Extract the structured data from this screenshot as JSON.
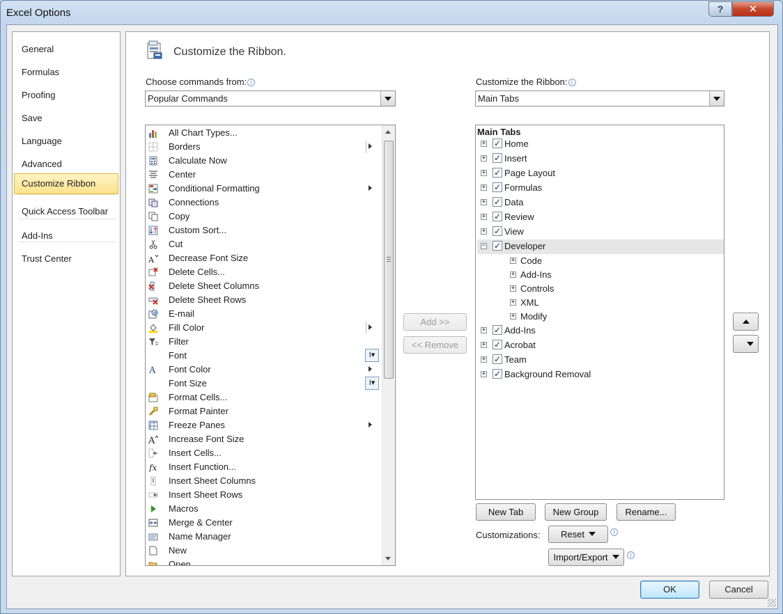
{
  "window": {
    "title": "Excel Options",
    "help_label": "?",
    "close_label": "✕"
  },
  "nav": {
    "items": [
      {
        "label": "General"
      },
      {
        "label": "Formulas"
      },
      {
        "label": "Proofing"
      },
      {
        "label": "Save"
      },
      {
        "label": "Language"
      },
      {
        "label": "Advanced"
      },
      {
        "label": "Customize Ribbon",
        "selected": true
      },
      {
        "label": "Quick Access Toolbar"
      },
      {
        "label": "Add-Ins"
      },
      {
        "label": "Trust Center"
      }
    ]
  },
  "header": {
    "title": "Customize the Ribbon.",
    "icon": "customize-ribbon-icon"
  },
  "left": {
    "label": "Choose commands from:",
    "dropdown_value": "Popular Commands",
    "commands": [
      {
        "label": "All Chart Types...",
        "icon": "chart-icon"
      },
      {
        "label": "Borders",
        "icon": "borders-icon",
        "submenu": true,
        "divider": true
      },
      {
        "label": "Calculate Now",
        "icon": "calculator-icon"
      },
      {
        "label": "Center",
        "icon": "align-center-icon"
      },
      {
        "label": "Conditional Formatting",
        "icon": "conditional-formatting-icon",
        "submenu": true
      },
      {
        "label": "Connections",
        "icon": "connections-icon"
      },
      {
        "label": "Copy",
        "icon": "copy-icon"
      },
      {
        "label": "Custom Sort...",
        "icon": "sort-icon"
      },
      {
        "label": "Cut",
        "icon": "scissors-icon"
      },
      {
        "label": "Decrease Font Size",
        "icon": "decrease-font-icon"
      },
      {
        "label": "Delete Cells...",
        "icon": "delete-cells-icon"
      },
      {
        "label": "Delete Sheet Columns",
        "icon": "delete-columns-icon"
      },
      {
        "label": "Delete Sheet Rows",
        "icon": "delete-rows-icon"
      },
      {
        "label": "E-mail",
        "icon": "email-icon"
      },
      {
        "label": "Fill Color",
        "icon": "fill-color-icon",
        "submenu": true,
        "divider": true
      },
      {
        "label": "Filter",
        "icon": "filter-icon"
      },
      {
        "label": "Font",
        "icon": "",
        "fontctl": true
      },
      {
        "label": "Font Color",
        "icon": "font-color-icon",
        "submenu": true
      },
      {
        "label": "Font Size",
        "icon": "",
        "fontctl": true
      },
      {
        "label": "Format Cells...",
        "icon": "format-cells-icon"
      },
      {
        "label": "Format Painter",
        "icon": "format-painter-icon"
      },
      {
        "label": "Freeze Panes",
        "icon": "freeze-panes-icon",
        "submenu": true
      },
      {
        "label": "Increase Font Size",
        "icon": "increase-font-icon"
      },
      {
        "label": "Insert Cells...",
        "icon": "insert-cells-icon"
      },
      {
        "label": "Insert Function...",
        "icon": "function-icon"
      },
      {
        "label": "Insert Sheet Columns",
        "icon": "insert-columns-icon"
      },
      {
        "label": "Insert Sheet Rows",
        "icon": "insert-rows-icon"
      },
      {
        "label": "Macros",
        "icon": "macro-play-icon"
      },
      {
        "label": "Merge & Center",
        "icon": "merge-center-icon"
      },
      {
        "label": "Name Manager",
        "icon": "name-manager-icon"
      },
      {
        "label": "New",
        "icon": "new-document-icon"
      },
      {
        "label": "Open",
        "icon": "open-folder-icon"
      }
    ]
  },
  "middle": {
    "add_label": "Add >>",
    "remove_label": "<< Remove"
  },
  "right": {
    "label": "Customize the Ribbon:",
    "dropdown_value": "Main Tabs",
    "tree_header": "Main Tabs",
    "nodes": [
      {
        "label": "Home",
        "level": 0,
        "expand": "+",
        "checked": true
      },
      {
        "label": "Insert",
        "level": 0,
        "expand": "+",
        "checked": true
      },
      {
        "label": "Page Layout",
        "level": 0,
        "expand": "+",
        "checked": true
      },
      {
        "label": "Formulas",
        "level": 0,
        "expand": "+",
        "checked": true
      },
      {
        "label": "Data",
        "level": 0,
        "expand": "+",
        "checked": true
      },
      {
        "label": "Review",
        "level": 0,
        "expand": "+",
        "checked": true
      },
      {
        "label": "View",
        "level": 0,
        "expand": "+",
        "checked": true
      },
      {
        "label": "Developer",
        "level": 0,
        "expand": "−",
        "checked": true,
        "selected": true
      },
      {
        "label": "Code",
        "level": 1,
        "expand": "+"
      },
      {
        "label": "Add-Ins",
        "level": 1,
        "expand": "+"
      },
      {
        "label": "Controls",
        "level": 1,
        "expand": "+"
      },
      {
        "label": "XML",
        "level": 1,
        "expand": "+"
      },
      {
        "label": "Modify",
        "level": 1,
        "expand": "+"
      },
      {
        "label": "Add-Ins",
        "level": 0,
        "expand": "+",
        "checked": true
      },
      {
        "label": "Acrobat",
        "level": 0,
        "expand": "+",
        "checked": true
      },
      {
        "label": "Team",
        "level": 0,
        "expand": "+",
        "checked": true
      },
      {
        "label": "Background Removal",
        "level": 0,
        "expand": "+",
        "checked": true
      }
    ],
    "new_tab_label": "New Tab",
    "new_group_label": "New Group",
    "rename_label": "Rename...",
    "customizations_label": "Customizations:",
    "reset_label": "Reset",
    "import_export_label": "Import/Export"
  },
  "footer": {
    "ok_label": "OK",
    "cancel_label": "Cancel"
  }
}
